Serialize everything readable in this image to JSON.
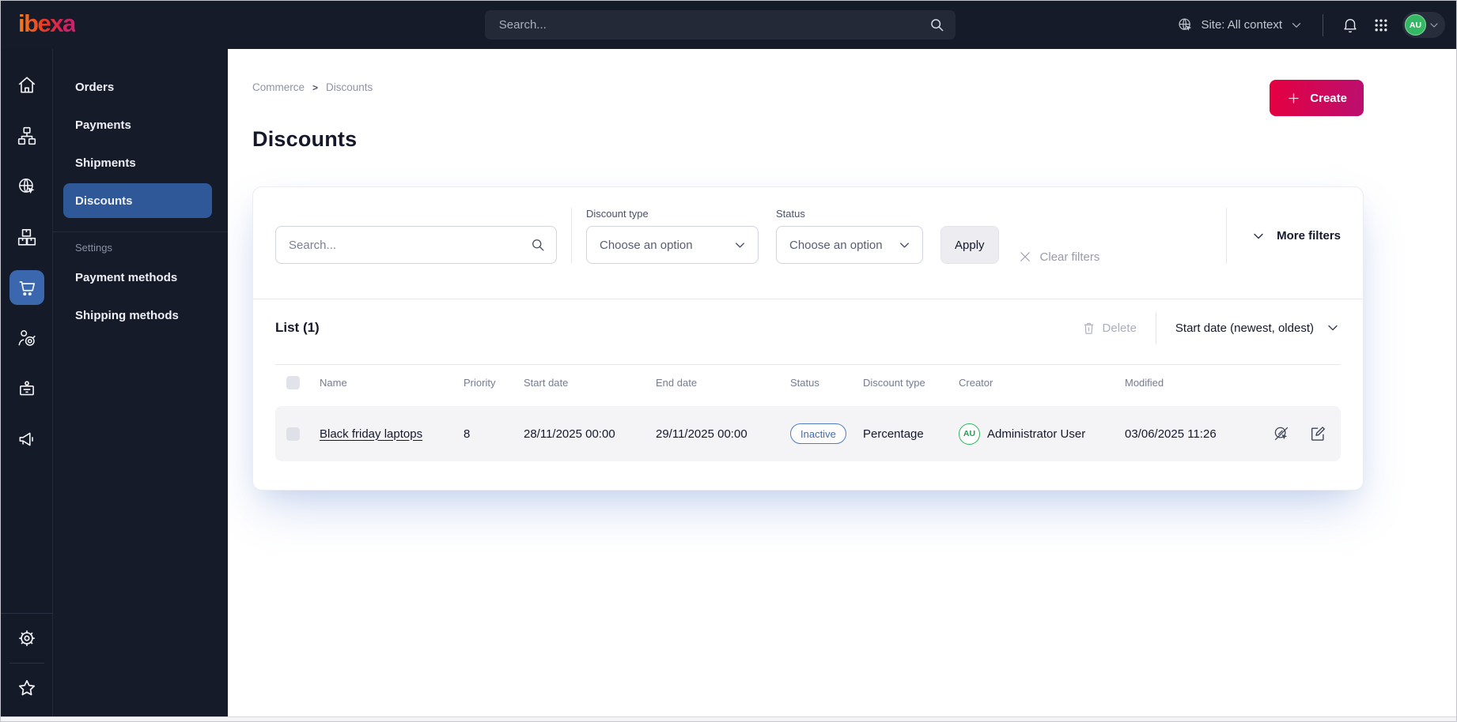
{
  "topbar": {
    "logo_text": "ibexa",
    "search_placeholder": "Search...",
    "site_context_label": "Site: All context",
    "user_initials": "AU"
  },
  "rail_items": [
    {
      "name": "dashboard",
      "icon": "home"
    },
    {
      "name": "content",
      "icon": "sitemap"
    },
    {
      "name": "site",
      "icon": "globe-cursor"
    },
    {
      "name": "products",
      "icon": "stacked-boxes"
    },
    {
      "name": "commerce",
      "icon": "shopping-cart",
      "active": true
    },
    {
      "name": "customers",
      "icon": "customer-target"
    },
    {
      "name": "admin",
      "icon": "id-badge"
    },
    {
      "name": "marketing",
      "icon": "megaphone"
    },
    {
      "name": "settings",
      "icon": "gear"
    },
    {
      "name": "favorites",
      "icon": "star"
    }
  ],
  "sidebar": {
    "items": [
      {
        "label": "Orders",
        "active": false
      },
      {
        "label": "Payments",
        "active": false
      },
      {
        "label": "Shipments",
        "active": false
      },
      {
        "label": "Discounts",
        "active": true
      }
    ],
    "settings_heading": "Settings",
    "settings_items": [
      {
        "label": "Payment methods"
      },
      {
        "label": "Shipping methods"
      }
    ]
  },
  "page": {
    "breadcrumb": {
      "items": [
        "Commerce",
        "Discounts"
      ],
      "separator": ">"
    },
    "title": "Discounts",
    "create_button": "Create"
  },
  "filters": {
    "search_placeholder": "Search...",
    "discount_type": {
      "label": "Discount type",
      "value": "Choose an option"
    },
    "status": {
      "label": "Status",
      "value": "Choose an option"
    },
    "apply_button": "Apply",
    "clear_button": "Clear filters",
    "more_filters_button": "More filters"
  },
  "list": {
    "heading": "List (1)",
    "delete_button": "Delete",
    "sort_by": "Start date (newest, oldest)",
    "columns": [
      "Name",
      "Priority",
      "Start date",
      "End date",
      "Status",
      "Discount type",
      "Creator",
      "Modified"
    ],
    "rows": [
      {
        "name": "Black friday laptops",
        "priority": "8",
        "start_date": "28/11/2025 00:00",
        "end_date": "29/11/2025 00:00",
        "status": "Inactive",
        "discount_type": "Percentage",
        "creator_initials": "AU",
        "creator_name": "Administrator User",
        "modified": "03/06/2025 11:26"
      }
    ]
  },
  "icons": {
    "global_search": "magnifier",
    "site_context": "globe-with-cursor",
    "notifications": "bell",
    "app_switcher": "3x3-dot-grid",
    "dropdowns": "chevron-down",
    "create": "plus",
    "clear_filters": "x-mark",
    "delete": "trash-can",
    "row_actions": [
      "deactivate-discount",
      "edit"
    ]
  },
  "colors": {
    "topbar_bg": "#161b29",
    "active_menu_bg": "#2e5897",
    "active_rail_bg": "#3a67ad",
    "create_gradient_start": "#e50040",
    "create_gradient_end": "#bb0f70",
    "inactive_badge": "#3f6db3",
    "avatar_green": "#2fb35c"
  }
}
